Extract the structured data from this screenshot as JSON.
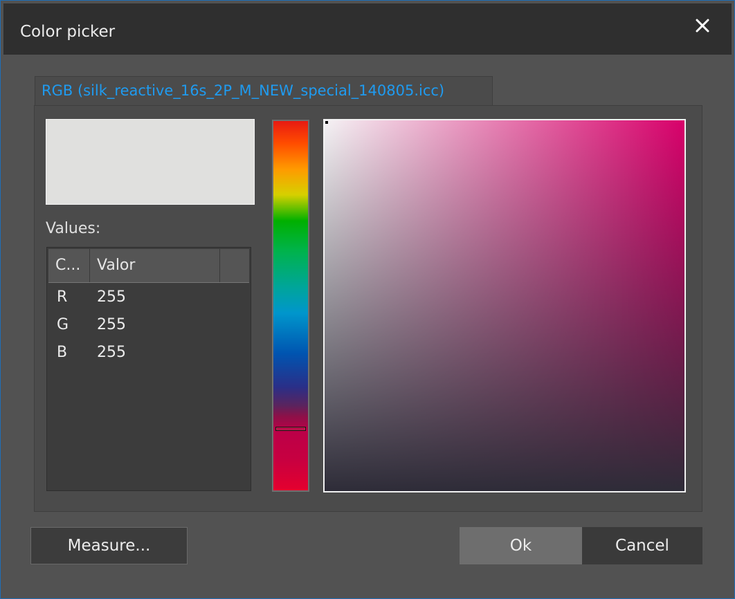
{
  "window": {
    "title": "Color picker"
  },
  "tab": {
    "label": "RGB (silk_reactive_16s_2P_M_NEW_special_140805.icc)"
  },
  "preview": {
    "color": "#e0e0de"
  },
  "values": {
    "label": "Values:",
    "columns": [
      "C...",
      "Valor",
      ""
    ],
    "rows": [
      {
        "channel": "R",
        "value": "255"
      },
      {
        "channel": "G",
        "value": "255"
      },
      {
        "channel": "B",
        "value": "255"
      }
    ]
  },
  "hue_slider": {
    "selected_color": "#c0004c"
  },
  "buttons": {
    "measure": "Measure...",
    "ok": "Ok",
    "cancel": "Cancel"
  },
  "icons": {
    "close": "close-icon"
  },
  "colors": {
    "accent": "#1f9bf0",
    "titlebar": "#2f2f2f",
    "body": "#525252"
  }
}
